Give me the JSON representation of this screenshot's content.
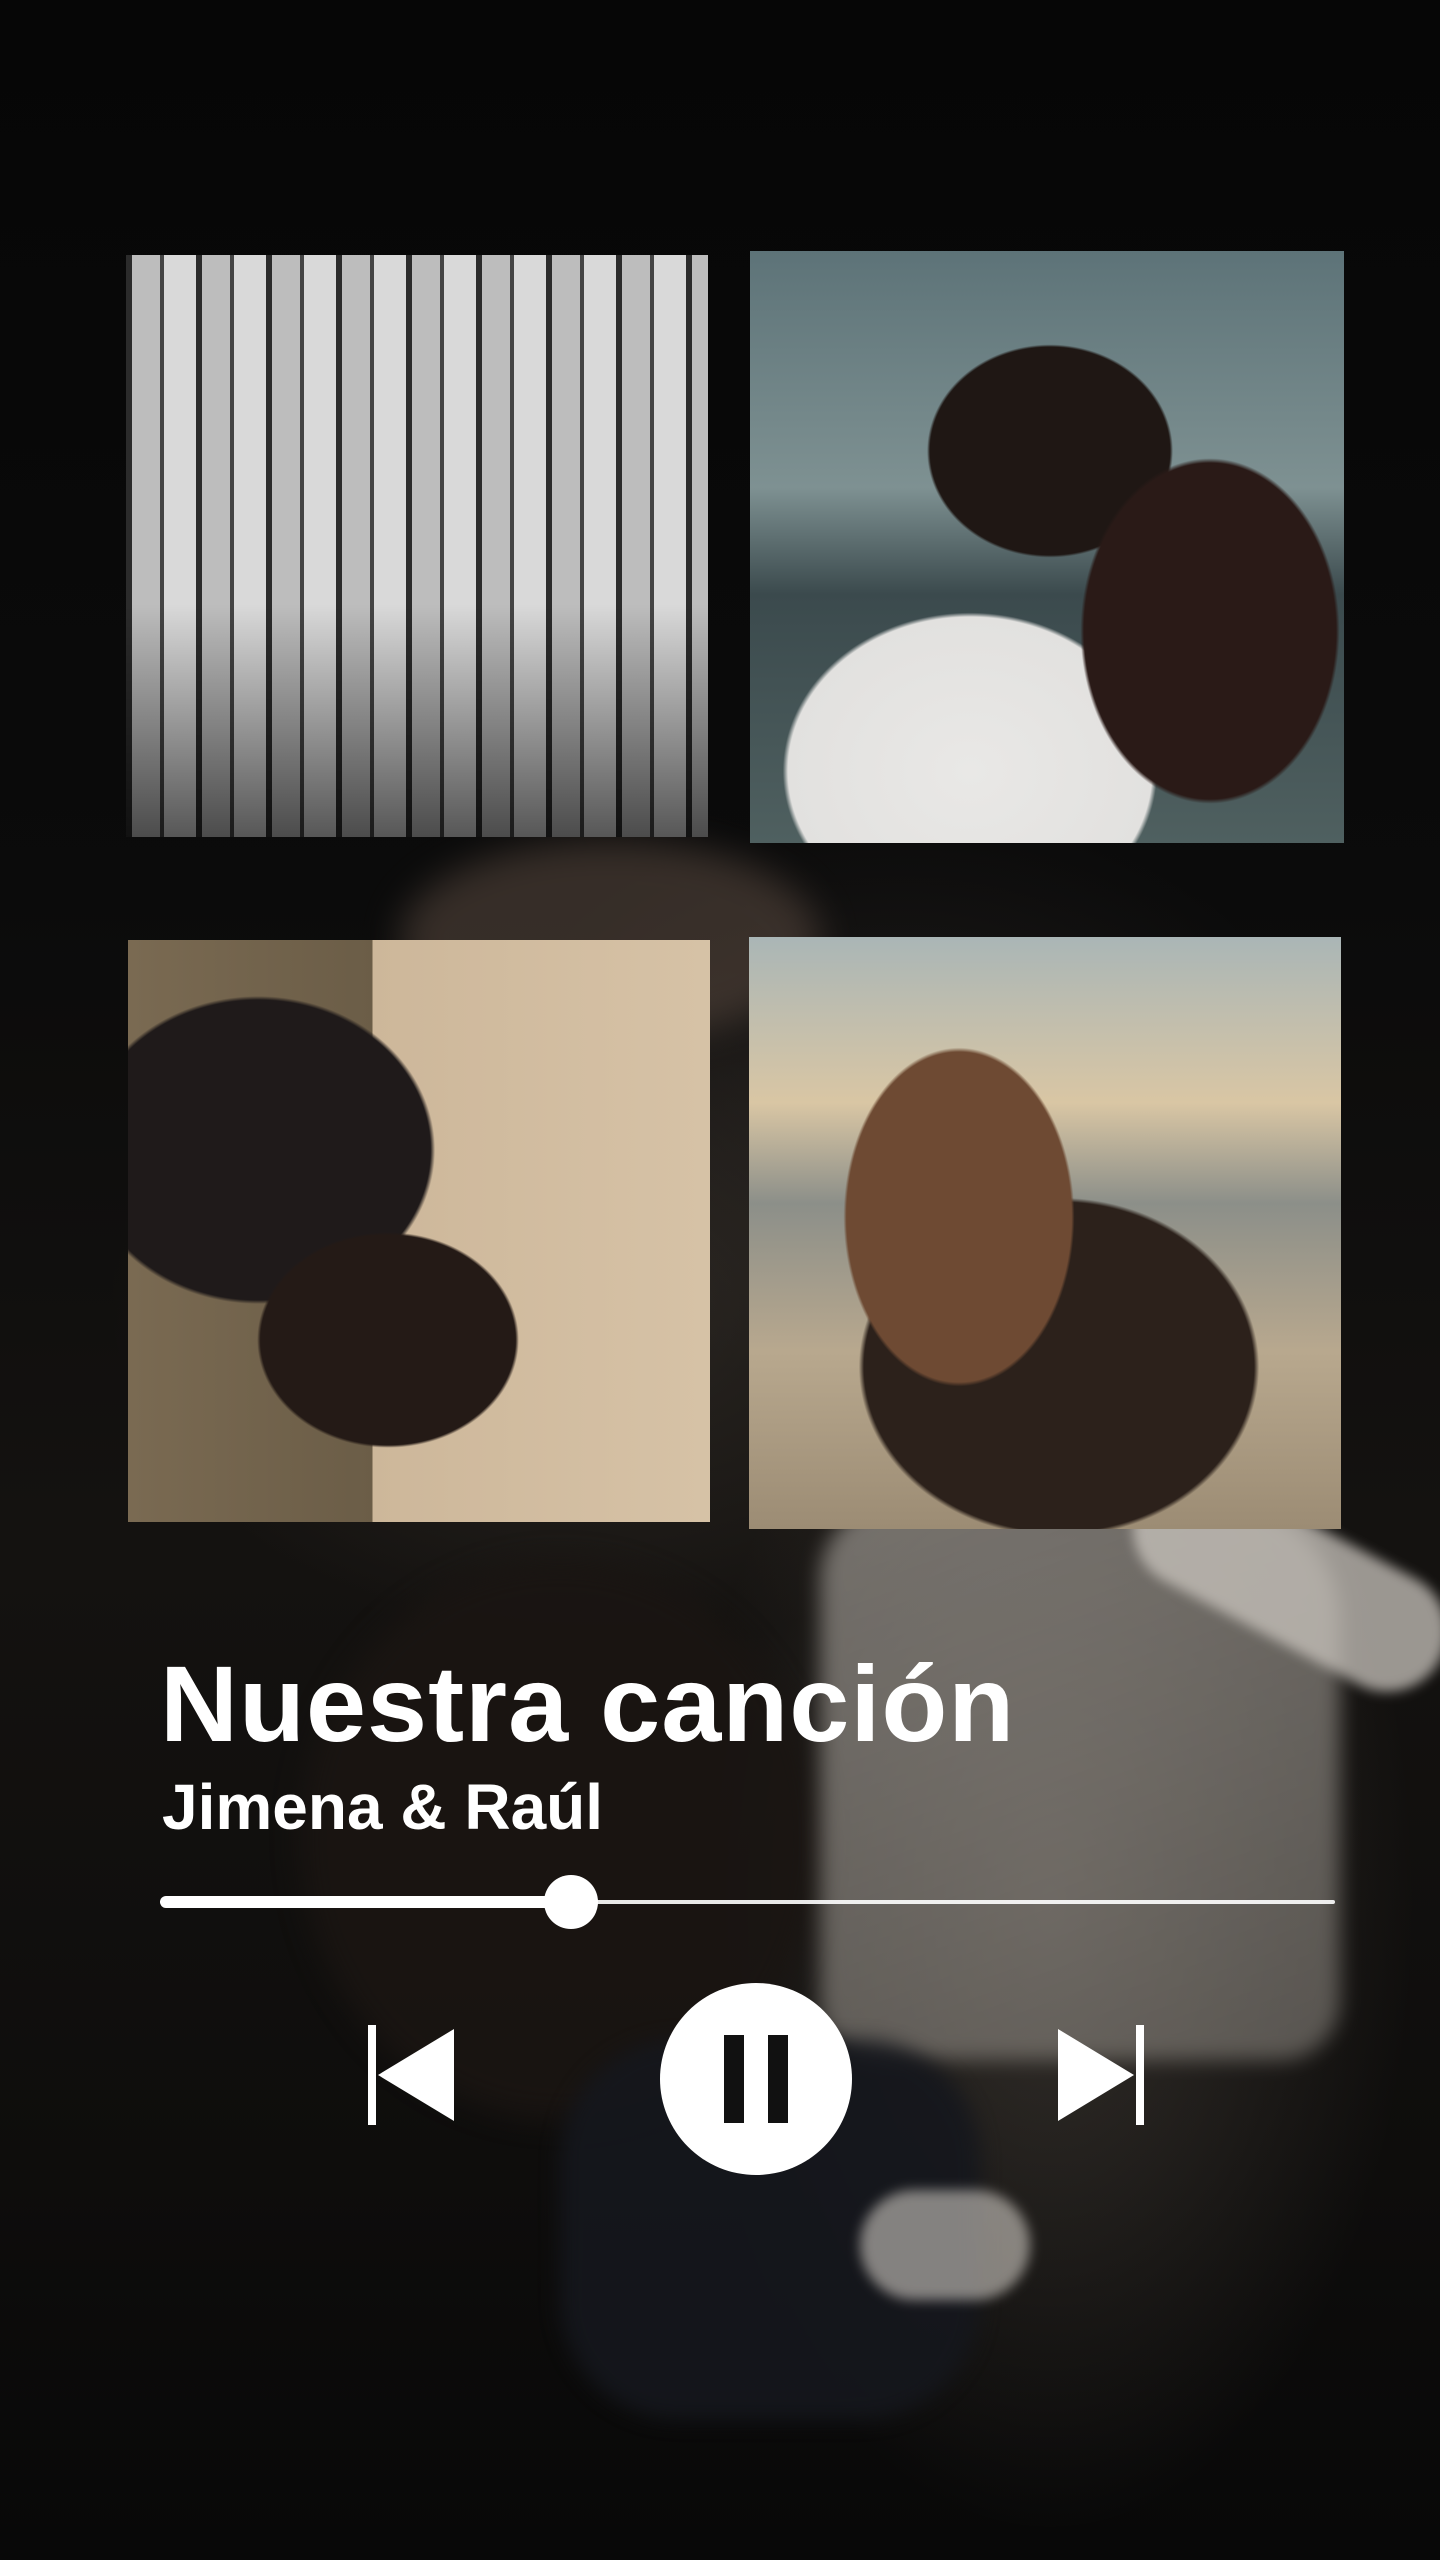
{
  "player": {
    "title": "Nuestra canción",
    "artist": "Jimena & Raúl",
    "progress": 0.35,
    "state": "playing"
  },
  "controls": {
    "previous_icon": "skip-previous-icon",
    "pause_icon": "pause-icon",
    "next_icon": "skip-next-icon"
  },
  "photos": [
    "photo-1",
    "photo-2",
    "photo-3",
    "photo-4"
  ],
  "colors": {
    "background": "#050505",
    "foreground": "#ffffff"
  }
}
